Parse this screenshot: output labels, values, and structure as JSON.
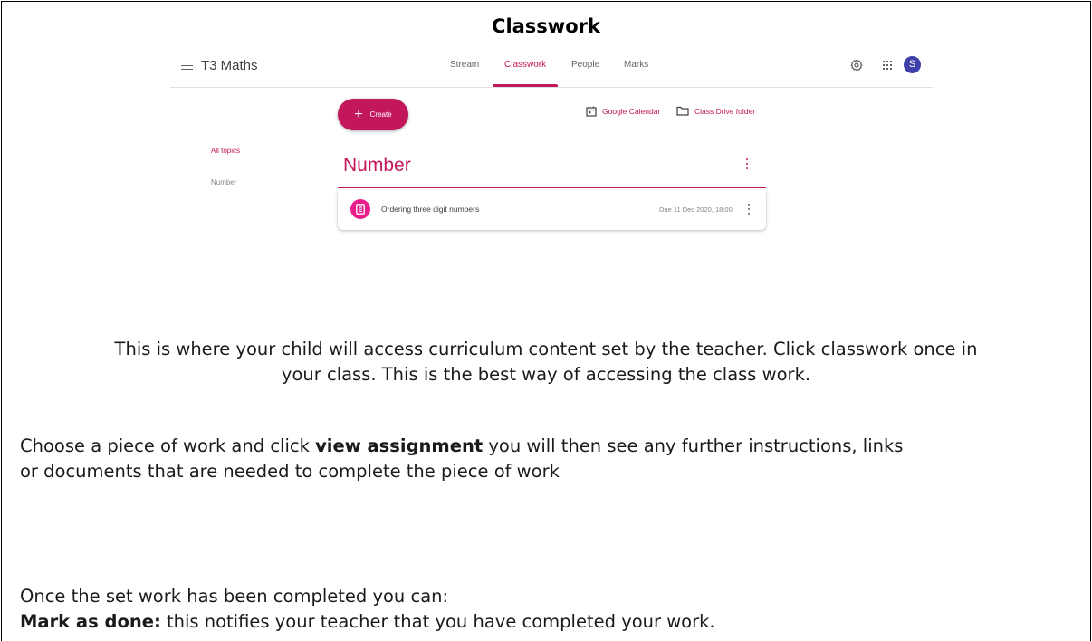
{
  "document": {
    "title": "Classwork"
  },
  "classroom": {
    "class_name": "T3 Maths",
    "tabs": [
      {
        "label": "Stream",
        "active": false
      },
      {
        "label": "Classwork",
        "active": true
      },
      {
        "label": "People",
        "active": false
      },
      {
        "label": "Marks",
        "active": false
      }
    ],
    "avatar_letter": "S",
    "create_label": "Create",
    "calendar_link": "Google Calendar",
    "drive_link": "Class Drive folder",
    "sidebar": {
      "all_topics": "All topics",
      "topic": "Number"
    },
    "topic_title": "Number",
    "assignment": {
      "title": "Ordering three digit numbers",
      "due": "Due 11 Dec 2020, 18:00"
    },
    "accent_color": "#c2185b",
    "icons": [
      "menu-icon",
      "settings-icon",
      "apps-icon",
      "calendar-icon",
      "folder-icon",
      "assignment-icon",
      "more-vert-icon"
    ]
  },
  "instructions": {
    "para1_line1": "This is where your child will access curriculum content set by the teacher. Click classwork once in",
    "para1_line2": "your class. This is the best way of accessing the class work.",
    "para2_before": "Choose a piece of work and click ",
    "para2_bold": "view assignment",
    "para2_after_line1": " you will then see any further instructions, links",
    "para2_line2": "or documents that are needed to complete the piece of work",
    "para3": "Once the set work has been completed you can:",
    "para4_bold": "Mark as done:",
    "para4_rest": " this notifies your teacher that you have completed your work."
  }
}
